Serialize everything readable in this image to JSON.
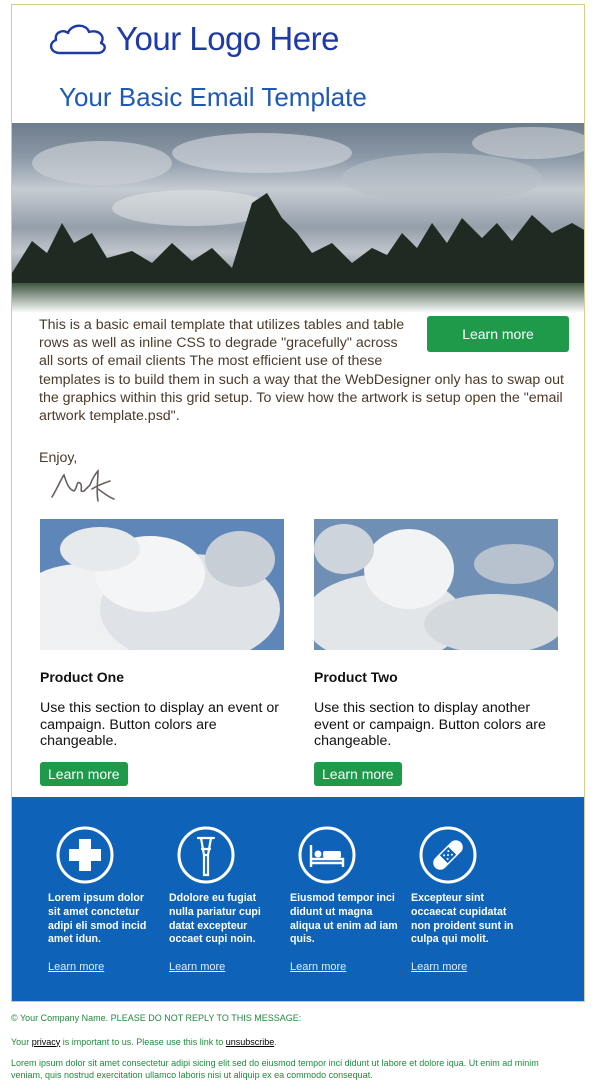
{
  "header": {
    "logo_text": "Your Logo Here",
    "logo_icon": "cloud-outline-icon",
    "title": "Your Basic Email Template"
  },
  "intro": {
    "text": "This is a basic email template that utilizes tables and table rows as well as inline CSS to degrade \"gracefully\" across all sorts of email clients The most efficient use of these templates is to build them in such a way that the WebDesigner only has to swap out the graphics within this grid setup. To view how the artwork is setup open the \"email artwork template.psd\".",
    "button_label": "Learn more",
    "signoff": "Enjoy,",
    "signature_icon": "handwritten-signature"
  },
  "products": [
    {
      "title": "Product One",
      "description": "Use this section to display an event or campaign. Button colors are changeable.",
      "button_label": "Learn more"
    },
    {
      "title": "Product Two",
      "description": "Use this section to display another event or campaign. Button colors are changeable.",
      "button_label": "Learn more"
    }
  ],
  "features": [
    {
      "icon": "medical-cross-icon",
      "text": "Lorem ipsum dolor sit amet conctetur adipi eli smod incid amet idun.",
      "link": "Learn more"
    },
    {
      "icon": "crutch-icon",
      "text": "Ddolore eu fugiat nulla pariatur cupi datat excepteur occaet cupi noin.",
      "link": "Learn more"
    },
    {
      "icon": "hospital-bed-icon",
      "text": "Eiusmod tempor inci didunt ut magna aliqua ut enim ad iam quis.",
      "link": "Learn more"
    },
    {
      "icon": "bandage-icon",
      "text": "Excepteur sint occaecat cupidatat non proident sunt in culpa qui molit.",
      "link": "Learn more"
    }
  ],
  "footer": {
    "company": "© Your Company Name. PLEASE DO NOT REPLY TO THIS MESSAGE:",
    "privacy_prefix": "Your ",
    "privacy_link": "privacy",
    "privacy_middle": " is important to us. Please use this link to ",
    "unsubscribe_link": "unsubscribe",
    "privacy_suffix": ".",
    "lorem": "Lorem ipsum dolor sit amet consectetur adipi sicing elit sed do eiusmod tempor inci didunt ut labore et dolore iqua. Ut enim ad minim veniam, quis nostrud exercitation ullamco laboris nisi ut aliquip ex ea commodo consequat."
  },
  "colors": {
    "brand_blue": "#1d3aa5",
    "headline_blue": "#1f58b5",
    "band_blue": "#0e63b8",
    "button_green": "#1f9a4b",
    "footer_green": "#1f8a3c"
  }
}
